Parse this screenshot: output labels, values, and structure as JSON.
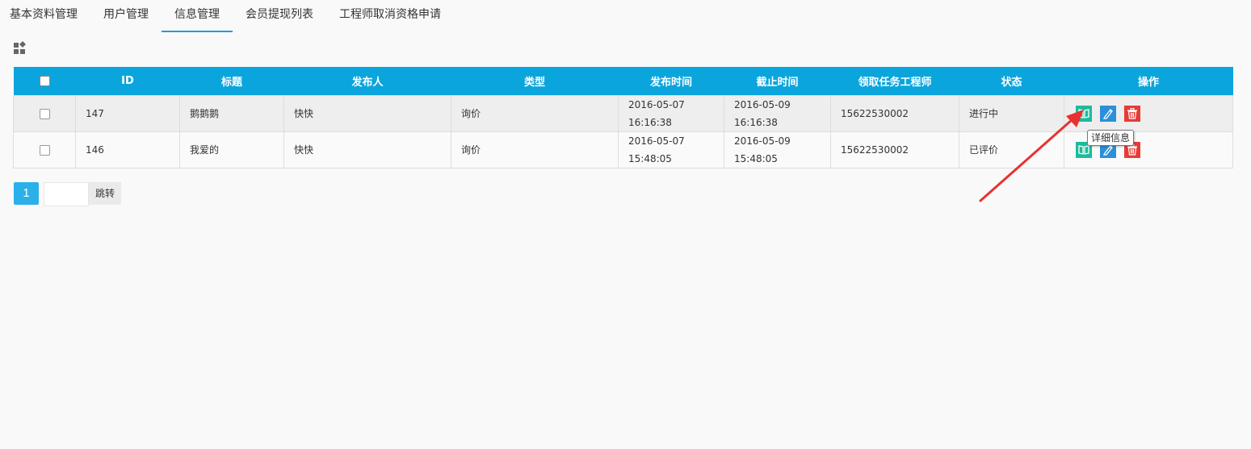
{
  "tabs": [
    {
      "label": "基本资料管理",
      "active": false
    },
    {
      "label": "用户管理",
      "active": false
    },
    {
      "label": "信息管理",
      "active": true
    },
    {
      "label": "会员提现列表",
      "active": false
    },
    {
      "label": "工程师取消资格申请",
      "active": false
    }
  ],
  "toolbar": {
    "icon": "grid-settings-icon"
  },
  "table": {
    "headers": [
      "ID",
      "标题",
      "发布人",
      "类型",
      "发布时间",
      "截止时间",
      "领取任务工程师",
      "状态",
      "操作"
    ],
    "rows": [
      {
        "id": "147",
        "title": "鹅鹅鹅",
        "publisher": "快快",
        "type": "询价",
        "publish_date": "2016-05-07",
        "publish_time": "16:16:38",
        "deadline_date": "2016-05-09",
        "deadline_time": "16:16:38",
        "engineer": "15622530002",
        "status": "进行中"
      },
      {
        "id": "146",
        "title": "我爱的",
        "publisher": "快快",
        "type": "询价",
        "publish_date": "2016-05-07",
        "publish_time": "15:48:05",
        "deadline_date": "2016-05-09",
        "deadline_time": "15:48:05",
        "engineer": "15622530002",
        "status": "已评价"
      }
    ]
  },
  "tooltip": {
    "text": "详细信息"
  },
  "pager": {
    "current": "1",
    "jump_label": "跳转",
    "input_value": ""
  },
  "colors": {
    "header": "#0ba5dd",
    "view": "#1bbc9b",
    "edit": "#2c8fd9",
    "delete": "#e83b36",
    "arrow": "#e8322f",
    "tab_active": "#1e9fd6"
  }
}
